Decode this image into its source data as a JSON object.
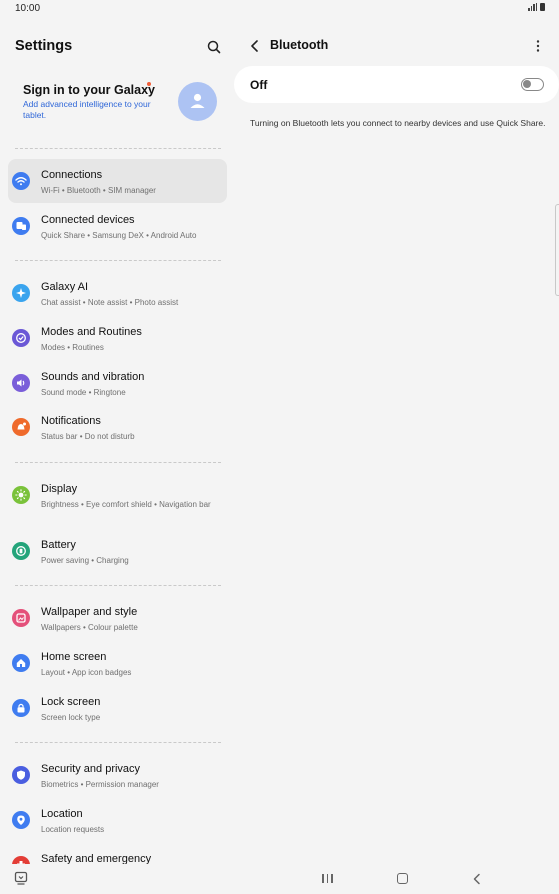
{
  "status_bar": {
    "time": "10:00"
  },
  "left_panel": {
    "title": "Settings",
    "account": {
      "title": "Sign in to your Galaxy",
      "subtitle": "Add advanced intelligence to your tablet."
    },
    "items": [
      {
        "title": "Connections",
        "subtitle": "Wi-Fi  •  Bluetooth  •  SIM manager",
        "icon": "wifi-icon",
        "color": "#3f7cf0",
        "active": true
      },
      {
        "title": "Connected devices",
        "subtitle": "Quick Share  •  Samsung DeX  •  Android Auto",
        "icon": "devices-icon",
        "color": "#3f7cf0"
      },
      {
        "title": "Galaxy AI",
        "subtitle": "Chat assist  •  Note assist  •  Photo assist",
        "icon": "sparkle-icon",
        "color": "#3aa4ee"
      },
      {
        "title": "Modes and Routines",
        "subtitle": "Modes  •  Routines",
        "icon": "check-circle-icon",
        "color": "#6b58d6"
      },
      {
        "title": "Sounds and vibration",
        "subtitle": "Sound mode  •  Ringtone",
        "icon": "speaker-icon",
        "color": "#7a5ed9"
      },
      {
        "title": "Notifications",
        "subtitle": "Status bar  •  Do not disturb",
        "icon": "bell-icon",
        "color": "#ef6a2b"
      },
      {
        "title": "Display",
        "subtitle": "Brightness  •  Eye comfort shield  •  Navigation bar",
        "icon": "sun-icon",
        "color": "#7ac23a"
      },
      {
        "title": "Battery",
        "subtitle": "Power saving  •  Charging",
        "icon": "battery-icon",
        "color": "#23a47a"
      },
      {
        "title": "Wallpaper and style",
        "subtitle": "Wallpapers  •  Colour palette",
        "icon": "wallpaper-icon",
        "color": "#e4507a"
      },
      {
        "title": "Home screen",
        "subtitle": "Layout  •  App icon badges",
        "icon": "home-icon",
        "color": "#3f7cf0"
      },
      {
        "title": "Lock screen",
        "subtitle": "Screen lock type",
        "icon": "lock-icon",
        "color": "#3f7cf0"
      },
      {
        "title": "Security and privacy",
        "subtitle": "Biometrics  •  Permission manager",
        "icon": "shield-icon",
        "color": "#4a5ee0"
      },
      {
        "title": "Location",
        "subtitle": "Location requests",
        "icon": "location-pin-icon",
        "color": "#3f7cf0"
      },
      {
        "title": "Safety and emergency",
        "subtitle": "",
        "icon": "emergency-icon",
        "color": "#e33d36"
      }
    ]
  },
  "right_panel": {
    "title": "Bluetooth",
    "toggle_label": "Off",
    "toggle_on": false,
    "description": "Turning on Bluetooth lets you connect to nearby devices and use Quick Share."
  }
}
